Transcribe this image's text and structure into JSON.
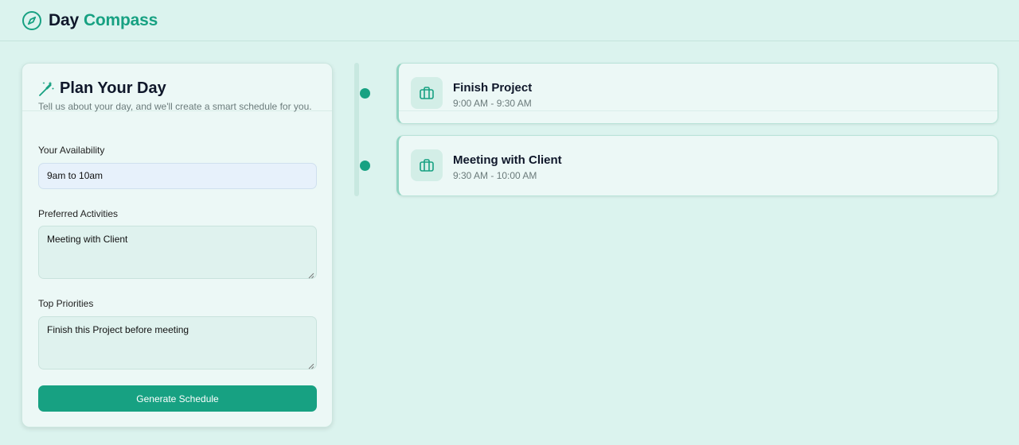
{
  "header": {
    "brand_part1": "Day",
    "brand_part2": "Compass"
  },
  "planner": {
    "title": "Plan Your Day",
    "subtitle": "Tell us about your day, and we'll create a smart schedule for you.",
    "availability_label": "Your Availability",
    "availability_value": "9am to 10am",
    "activities_label": "Preferred Activities",
    "activities_value": "Meeting with Client",
    "priorities_label": "Top Priorities",
    "priorities_value": "Finish this Project before meeting",
    "generate_label": "Generate Schedule"
  },
  "schedule": [
    {
      "title": "Finish Project",
      "time": "9:00 AM - 9:30 AM",
      "icon": "briefcase-icon"
    },
    {
      "title": "Meeting with Client",
      "time": "9:30 AM - 10:00 AM",
      "icon": "briefcase-icon"
    }
  ],
  "colors": {
    "accent": "#17a182",
    "background": "#dbf3ee",
    "card": "#ecf8f6"
  }
}
